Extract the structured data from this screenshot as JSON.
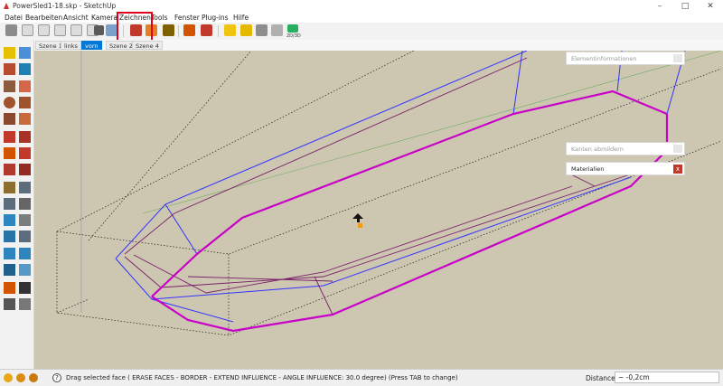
{
  "window": {
    "title": "PowerSled1-18.skp - SketchUp",
    "controls": [
      "–",
      "□",
      "✕"
    ]
  },
  "menu": {
    "items": [
      "Datei",
      "Bearbeiten",
      "Ansicht",
      "Kamera",
      "Zeichnen",
      "Tools",
      "Fenster",
      "Plug-ins",
      "Hilfe"
    ]
  },
  "toolbar": {
    "icons": [
      "iso-view-icon",
      "top-view-icon",
      "front-view-icon",
      "right-view-icon",
      "back-view-icon",
      "left-view-icon",
      "xray-style-icon",
      "wireframe-style-icon",
      "hidden-line-style-icon",
      "shaded-style-icon",
      "push-pull-tool-icon",
      "sandbox-tool-icon",
      "north-arrow-icon",
      "paint-bucket-icon",
      "extension-icon",
      "camera-position-icon",
      "walk-icon",
      "components-icon",
      "warehouse-icon",
      "export-icon"
    ],
    "export_label": "2D/3D"
  },
  "scenes": {
    "tabs": [
      "Szene 1",
      "links",
      "vorn",
      "Szene 2",
      "Szene 4"
    ],
    "active_index": 2
  },
  "panels": {
    "entity_info": "Elementinformationen",
    "soften_edges": "Kanten abmildern",
    "materials": "Materialien",
    "close_label": "x"
  },
  "status": {
    "text": "Drag selected face ( ERASE FACES - BORDER - EXTEND INFLUENCE - ANGLE INFLUENCE: 30.0  degree)  (Press TAB to change)",
    "measure_label": "Distance",
    "measure_value": "~ -0,2cm"
  },
  "colors": {
    "viewport_bg": "#cdc7b1",
    "highlight_box": "#e0001b",
    "edge_magenta": "#c800c8",
    "edge_blue": "#3333ff",
    "active_tab": "#0078d7"
  }
}
